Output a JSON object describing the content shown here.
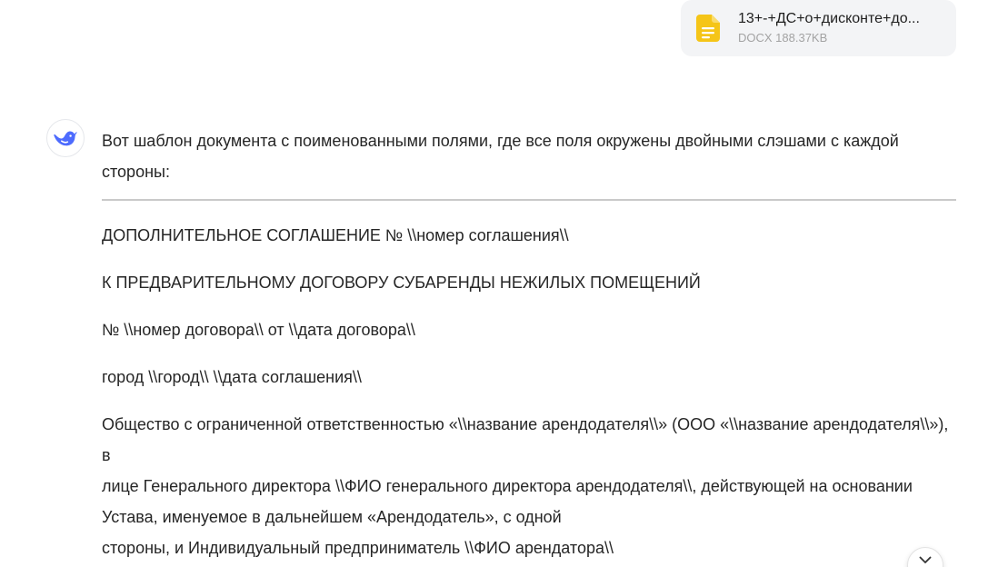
{
  "attachment": {
    "file_name": "13+-+ДС+о+дисконте+до...",
    "file_meta": "DOCX 188.37KB",
    "icon": "document-icon",
    "icon_color": "#f5c518"
  },
  "assistant": {
    "avatar_icon": "whale-logo-icon",
    "accent": "#4d6bfe",
    "intro": "Вот шаблон документа с поименованными полями, где все поля окружены двойными слэшами с каждой стороны:",
    "document": {
      "line1": "ДОПОЛНИТЕЛЬНОЕ СОГЛАШЕНИЕ № \\\\номер соглашения\\\\",
      "line2": "К ПРЕДВАРИТЕЛЬНОМУ ДОГОВОРУ СУБАРЕНДЫ НЕЖИЛЫХ ПОМЕЩЕНИЙ",
      "line3": "№ \\\\номер договора\\\\ от \\\\дата договора\\\\",
      "line4": "город \\\\город\\\\ \\\\дата соглашения\\\\",
      "para5": [
        "Общество с ограниченной ответственностью «\\\\название арендодателя\\\\» (ООО «\\\\название арендодателя\\\\»), в",
        "лице Генерального директора \\\\ФИО генерального директора арендодателя\\\\, действующей на основании Устава, именуемое в дальнейшем «Арендодатель», с одной",
        "стороны, и Индивидуальный предприниматель \\\\ФИО арендатора\\\\"
      ]
    }
  },
  "scroll_button": {
    "icon": "chevron-down-icon"
  }
}
